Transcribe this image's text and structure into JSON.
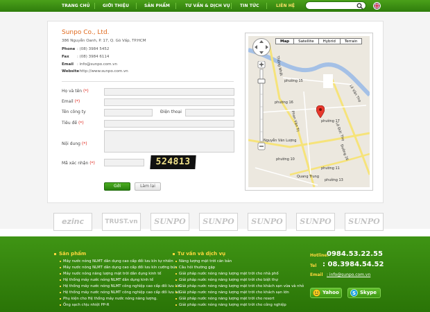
{
  "nav": {
    "items": [
      "TRANG CHỦ",
      "GIỚI THIỆU",
      "SẢN PHẨM",
      "TƯ VẤN & DỊCH VỤ",
      "TIN TỨC",
      "LIÊN HỆ"
    ],
    "active": "LIÊN HỆ",
    "search_placeholder": ""
  },
  "contact": {
    "company": "Sunpo Co., Ltd.",
    "address": "386 Nguyễn Oanh, P. 17, Q. Gò Vấp, TP.HCM",
    "phone_label": "Phone",
    "phone": ": (08) 3984 5452",
    "fax_label": "Fax",
    "fax": ": (08) 3984 6114",
    "email_label": "Email",
    "email": ": info@sunpo.com.vn",
    "website_label": "Website",
    "website": ": http://www.sunpo.com.vn"
  },
  "form": {
    "name_label": "Họ và tên",
    "email_label": "Email",
    "company_label": "Tên công ty",
    "phone_label": "Điện thoại",
    "subject_label": "Tiêu đề",
    "content_label": "Nội dung",
    "captcha_label": "Mã xác nhận",
    "required_mark": "(*)",
    "captcha_code": "524813",
    "submit_label": "Gởi",
    "reset_label": "Làm lại"
  },
  "map": {
    "tabs": [
      "Map",
      "Satellite",
      "Hybrid",
      "Terrain"
    ],
    "selected_tab": "Map",
    "labels": [
      "phường 15",
      "phường 16",
      "phường 17",
      "phường 10",
      "phường 11",
      "phường 13",
      "Nguyễn Văn Lượng",
      "Quang Trung",
      "Lê Đức Thọ",
      "Thống Nhất",
      "Phan Văn Trị",
      "Lê Văn Thọ",
      "Đường 26"
    ]
  },
  "partners": [
    "ezinc",
    "TRUST.vn",
    "SUNPO",
    "SUNPO",
    "SUNPO",
    "SUNPO",
    "SUNPO"
  ],
  "footer": {
    "products_title": "Sản phẩm",
    "products": [
      "Máy nước nóng NLMT dân dụng cao cấp đối lưu kín tự nhiên",
      "Máy nước nóng NLMT dân dụng cao cấp đối lưu kín cưỡng bức",
      "Máy nước nóng năng lượng mặt trời dân dụng kinh tế",
      "Hệ thống máy nước nóng NLMT dân dụng kinh tế",
      "Hệ thống máy nước nóng NLMT công nghiệp cao cấp đối lưu kín",
      "Hệ thống máy nước nóng NLMT công nghiệp cao cấp đối lưu hở",
      "Phụ kiện cho Hệ thống máy nước nóng năng lượng.",
      "Ống sạch chịu nhiệt PP-R"
    ],
    "services_title": "Tư vấn và dịch vụ",
    "services": [
      "Năng lượng mặt trời căn bản",
      "Câu hỏi thường gặp",
      "Giải pháp nước nóng năng lượng mặt trời cho nhà phố",
      "Giải pháp nước nóng năng lượng mặt trời cho biệt thự",
      "Giải pháp nước nóng năng lượng mặt trời cho khách sạn vừa và nhỏ",
      "Giải pháp nước nóng năng lượng mặt trời cho khách sạn lớn",
      "Giải pháp nước nóng năng lượng mặt trời cho resort",
      "Giải pháp nước nóng năng lượng mặt trời cho công nghiệp"
    ],
    "hotline_label": "Hotline:",
    "hotline": "0984.53.22.55",
    "tel_label": "Tel",
    "tel": ": 08.3984.54.52",
    "email_label": "Email",
    "email": ": info@sunpo.com.vn",
    "yahoo_label": "Yahoo",
    "skype_label": "Skype"
  },
  "colors": {
    "nav_green": "#2f7d0c",
    "accent_orange": "#e06a1e",
    "footer_yellow": "#ffd83d",
    "required_red": "#e0251b"
  }
}
